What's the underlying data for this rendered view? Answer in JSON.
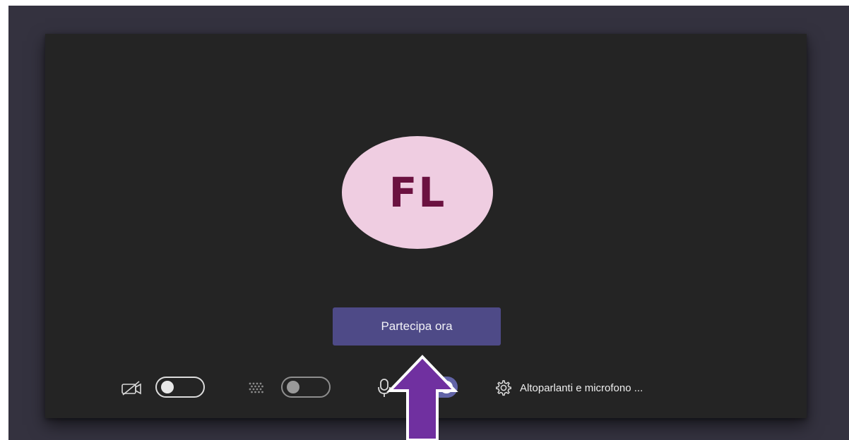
{
  "avatar": {
    "initials": "FL",
    "color": "#efcde1",
    "text_color": "#6b1240"
  },
  "join_button": {
    "label": "Partecipa ora",
    "color": "#4e4a87"
  },
  "controls": {
    "camera": {
      "icon": "camera-off-icon",
      "state": "off"
    },
    "background_blur": {
      "icon": "background-blur-icon",
      "state": "off"
    },
    "microphone": {
      "icon": "microphone-icon",
      "state": "on"
    },
    "device_settings": {
      "icon": "gear-icon",
      "label": "Altoparlanti e microfono ..."
    }
  },
  "annotation": {
    "type": "arrow-up",
    "color": "#7030a0"
  },
  "colors": {
    "outer_background": "#34323f",
    "panel_background": "#242424",
    "toggle_on": "#6264a7"
  }
}
